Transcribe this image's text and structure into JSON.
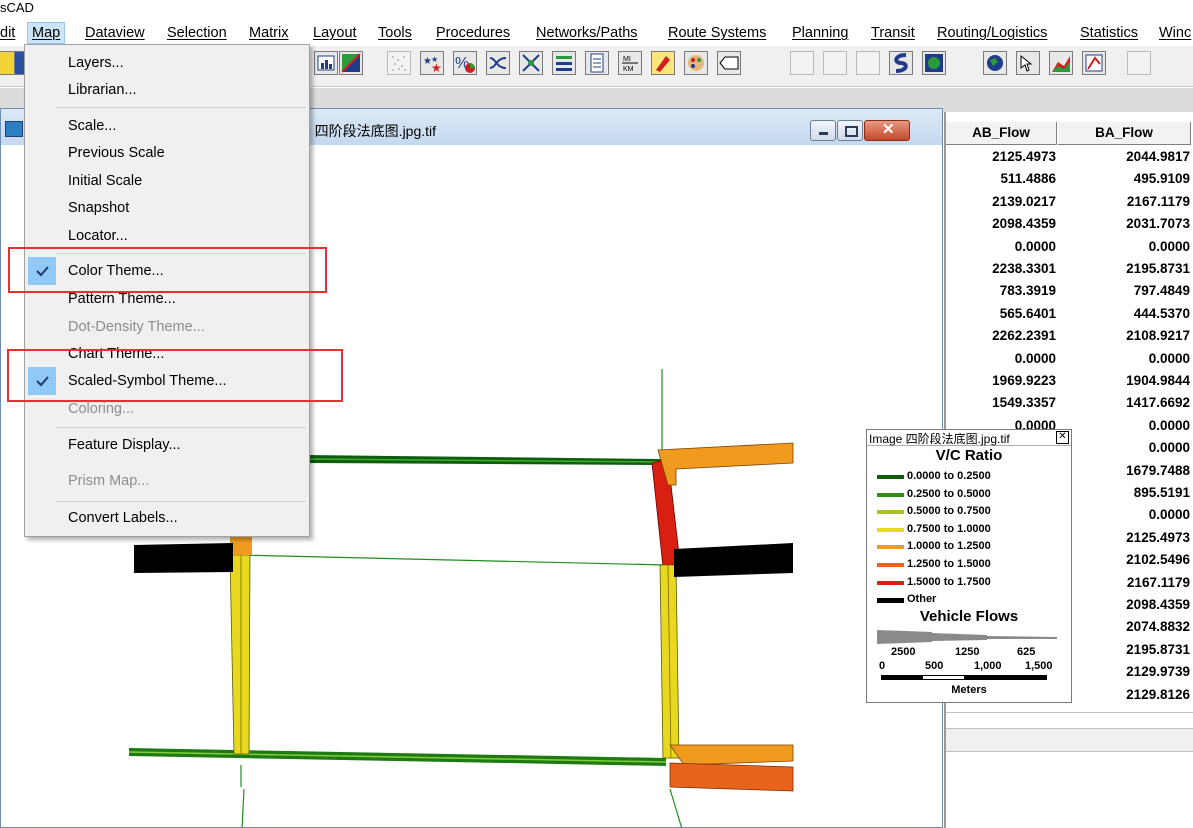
{
  "titlebar": {
    "title": "sCAD"
  },
  "menubar": {
    "items": [
      "dit",
      "Map",
      "Dataview",
      "Selection",
      "Matrix",
      "Layout",
      "Tools",
      "Procedures",
      "Networks/Paths",
      "Route Systems",
      "Planning",
      "Transit",
      "Routing/Logistics",
      "Statistics",
      "Winc"
    ]
  },
  "map_menu": {
    "items": [
      {
        "label": "Layers...",
        "enabled": true,
        "checked": false
      },
      {
        "label": "Librarian...",
        "enabled": true,
        "checked": false
      },
      {
        "label": "Scale...",
        "enabled": true,
        "checked": false
      },
      {
        "label": "Previous Scale",
        "enabled": true,
        "checked": false
      },
      {
        "label": "Initial Scale",
        "enabled": true,
        "checked": false
      },
      {
        "label": "Snapshot",
        "enabled": true,
        "checked": false
      },
      {
        "label": "Locator...",
        "enabled": true,
        "checked": false
      },
      {
        "label": "Color Theme...",
        "enabled": true,
        "checked": true
      },
      {
        "label": "Pattern Theme...",
        "enabled": true,
        "checked": false
      },
      {
        "label": "Dot-Density Theme...",
        "enabled": false,
        "checked": false
      },
      {
        "label": "Chart Theme...",
        "enabled": true,
        "checked": false
      },
      {
        "label": "Scaled-Symbol Theme...",
        "enabled": true,
        "checked": true
      },
      {
        "label": "Coloring...",
        "enabled": false,
        "checked": false
      },
      {
        "label": "Feature Display...",
        "enabled": true,
        "checked": false
      },
      {
        "label": "Prism Map...",
        "enabled": false,
        "checked": false
      },
      {
        "label": "Convert Labels...",
        "enabled": true,
        "checked": false
      }
    ]
  },
  "map_window": {
    "title": "e 四阶段法底图.jpg.tif"
  },
  "dataview": {
    "columns": [
      "AB_Flow",
      "BA_Flow"
    ],
    "ab_flow": [
      "2125.4973",
      "511.4886",
      "2139.0217",
      "2098.4359",
      "0.0000",
      "2238.3301",
      "783.3919",
      "565.6401",
      "2262.2391",
      "0.0000",
      "1969.9223",
      "1549.3357",
      "0.0000"
    ],
    "ba_flow": [
      "2044.9817",
      "495.9109",
      "2167.1179",
      "2031.7073",
      "0.0000",
      "2195.8731",
      "797.4849",
      "444.5370",
      "2108.9217",
      "0.0000",
      "1904.9844",
      "1417.6692",
      "0.0000",
      "0.0000",
      "1679.7488",
      "895.5191",
      "0.0000",
      "2125.4973",
      "2102.5496",
      "2167.1179",
      "2098.4359",
      "2074.8832",
      "2195.8731",
      "2129.9739",
      "2129.8126"
    ]
  },
  "legend": {
    "title": "Image 四阶段法底图.jpg.tif",
    "vc_title": "V/C Ratio",
    "vc_items": [
      {
        "label": "0.0000 to 0.2500",
        "color": "#0e5c0e"
      },
      {
        "label": "0.2500 to 0.5000",
        "color": "#2f8f12"
      },
      {
        "label": "0.5000 to 0.7500",
        "color": "#a7c51f"
      },
      {
        "label": "0.7500 to 1.0000",
        "color": "#e9d820"
      },
      {
        "label": "1.0000 to 1.2500",
        "color": "#f09b1e"
      },
      {
        "label": "1.2500 to 1.5000",
        "color": "#e8641c"
      },
      {
        "label": "1.5000 to 1.7500",
        "color": "#d91e12"
      },
      {
        "label": "Other",
        "color": "#000000"
      }
    ],
    "flows_title": "Vehicle Flows",
    "flow_values": [
      "2500",
      "1250",
      "625"
    ],
    "scale_labels": [
      "0",
      "500",
      "1,000",
      "1,500"
    ],
    "scale_unit": "Meters"
  },
  "colors": {
    "highlight_box": "#e33232",
    "menu_active": "#cce4f7",
    "check_bg": "#90c8f6"
  }
}
